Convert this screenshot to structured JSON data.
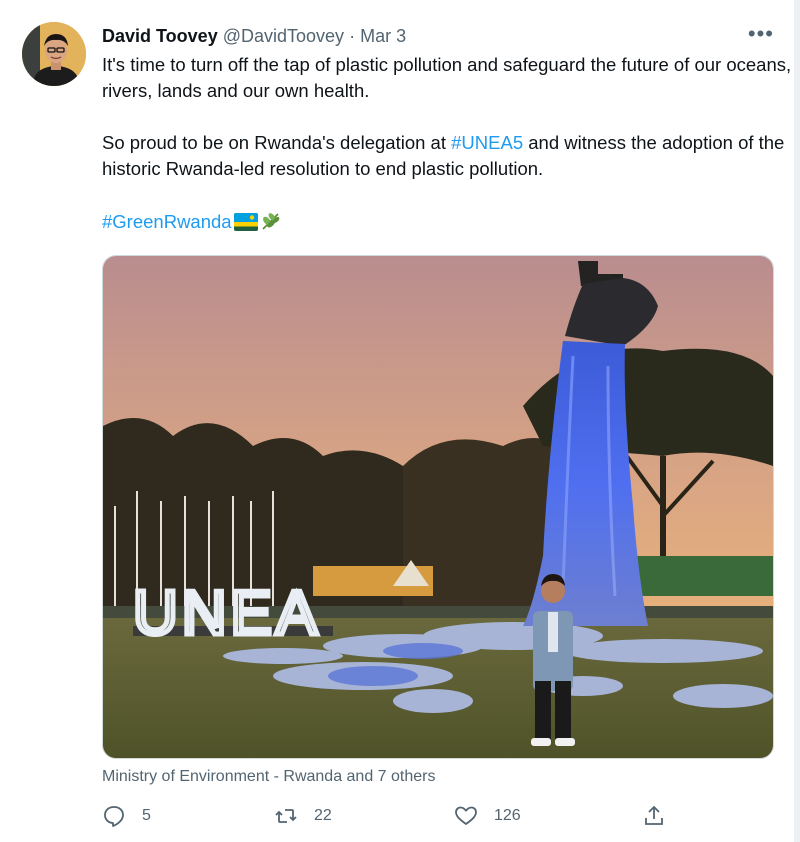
{
  "tweet": {
    "author_name": "David Toovey",
    "author_handle": "@DavidToovey",
    "separator": "·",
    "date": "Mar 3",
    "more_label": "•••",
    "line1": "It's time to turn off the tap of plastic pollution and safeguard the future of our oceans, rivers, lands and our own health.",
    "line2_before": "So proud to be on Rwanda's delegation at ",
    "line2_hashtag": "#UNEA5",
    "line2_after": " and witness the adoption of the historic Rwanda-led resolution to end plastic pollution.",
    "line3_hashtag": "#GreenRwanda",
    "image_sign_text": "UNEA",
    "liked_by": "Ministry of Environment - Rwanda and 7 others",
    "reply_count": "5",
    "retweet_count": "22",
    "like_count": "126"
  },
  "icons": {
    "avatar": "avatar-photo",
    "more": "more-icon",
    "flag": "rwanda-flag-emoji",
    "herb": "herb-emoji",
    "reply": "reply-icon",
    "retweet": "retweet-icon",
    "like": "heart-icon",
    "share": "share-icon"
  },
  "colors": {
    "hashtag": "#1d9bf0",
    "text": "#0f1419",
    "muted": "#536471"
  }
}
